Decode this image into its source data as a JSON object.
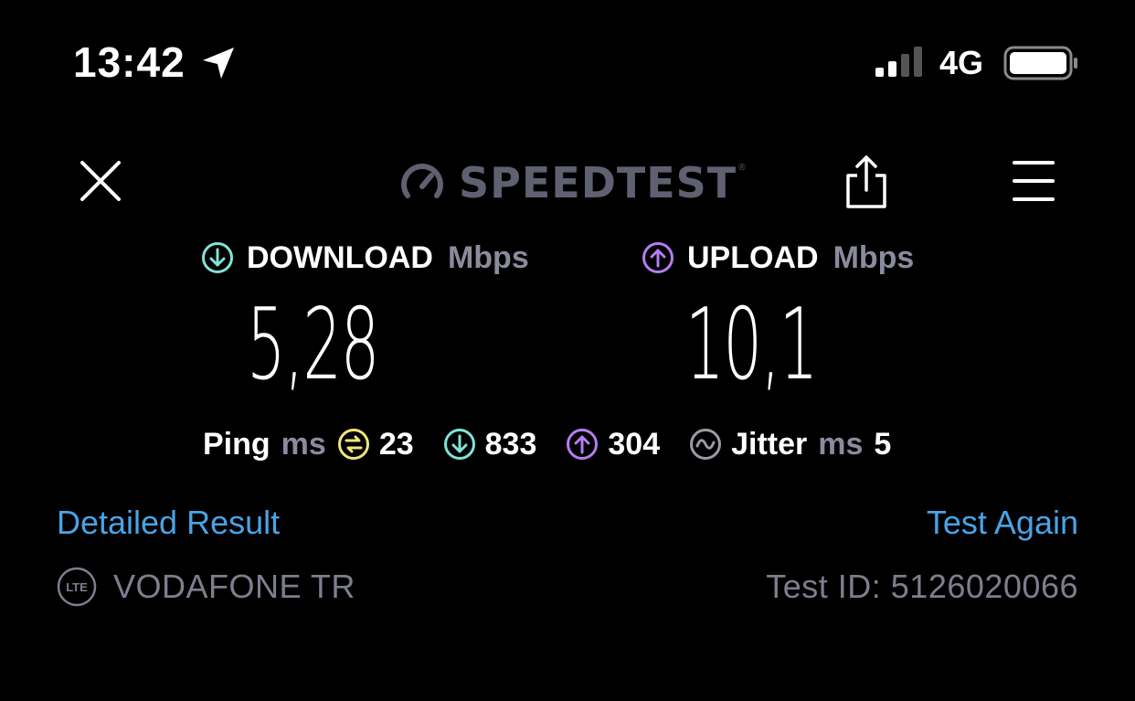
{
  "status_bar": {
    "time": "13:42",
    "network": "4G",
    "signal_bars_active": 2,
    "signal_bars_total": 4,
    "battery_level": 0.95
  },
  "header": {
    "logo_text": "SPEEDTEST",
    "logo_tm": "®",
    "icons": [
      "close-icon",
      "speedometer-icon",
      "share-icon",
      "menu-icon"
    ]
  },
  "download": {
    "label": "DOWNLOAD",
    "unit": "Mbps",
    "value": "5,28",
    "color": "#7fe3d8"
  },
  "upload": {
    "label": "UPLOAD",
    "unit": "Mbps",
    "value": "10,1",
    "color": "#b77cf0"
  },
  "ping": {
    "label": "Ping",
    "unit": "ms",
    "idle": "23",
    "download": "833",
    "upload": "304",
    "idle_color": "#f2e47a"
  },
  "jitter": {
    "label": "Jitter",
    "unit": "ms",
    "value": "5"
  },
  "links": {
    "detailed": "Detailed Result",
    "again": "Test Again"
  },
  "footer": {
    "connection_badge": "LTE",
    "provider": "VODAFONE TR",
    "test_id": "Test ID: 5126020066"
  }
}
